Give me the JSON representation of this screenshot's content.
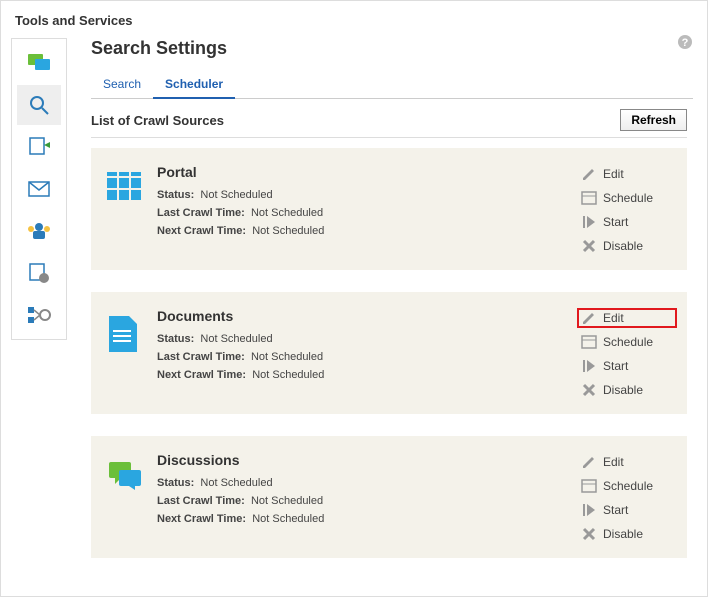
{
  "header": "Tools and Services",
  "title": "Search Settings",
  "tabs": {
    "search": "Search",
    "scheduler": "Scheduler"
  },
  "list_header": "List of Crawl Sources",
  "refresh": "Refresh",
  "labels": {
    "status": "Status:",
    "last": "Last Crawl Time:",
    "next": "Next Crawl Time:"
  },
  "actions": {
    "edit": "Edit",
    "schedule": "Schedule",
    "start": "Start",
    "disable": "Disable"
  },
  "sources": [
    {
      "name": "Portal",
      "status": "Not Scheduled",
      "last": "Not Scheduled",
      "next": "Not Scheduled"
    },
    {
      "name": "Documents",
      "status": "Not Scheduled",
      "last": "Not Scheduled",
      "next": "Not Scheduled"
    },
    {
      "name": "Discussions",
      "status": "Not Scheduled",
      "last": "Not Scheduled",
      "next": "Not Scheduled"
    }
  ]
}
